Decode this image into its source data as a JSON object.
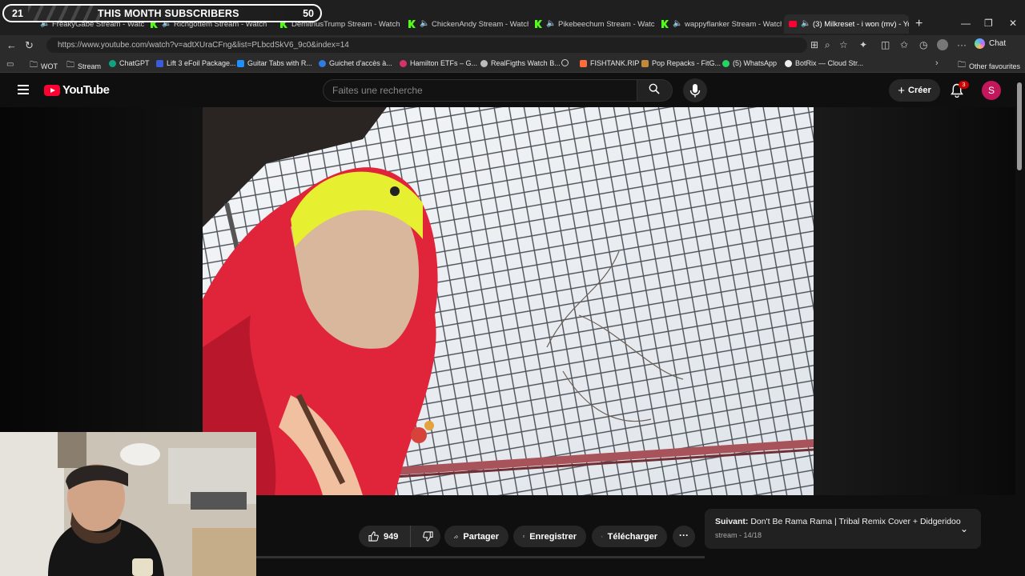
{
  "overlay": {
    "current": "21",
    "title": "THIS MONTH SUBSCRIBERS",
    "goal": "50"
  },
  "tabs": [
    {
      "label": "FreakyGabe Stream - Watch",
      "type": "kick"
    },
    {
      "label": "Richgottem Stream - Watch",
      "type": "kick"
    },
    {
      "label": "DemitriusTrump Stream - Watch L",
      "type": "kick"
    },
    {
      "label": "ChickenAndy Stream - Watch",
      "type": "kick"
    },
    {
      "label": "Pikebeechum Stream - Watch",
      "type": "kick"
    },
    {
      "label": "wappyflanker Stream - Watch",
      "type": "kick"
    },
    {
      "label": "(3) Milkreset - i won (mv) - Yo",
      "type": "youtube"
    }
  ],
  "address": {
    "url": "https://www.youtube.com/watch?v=adtXUraCFng&list=PLbcdSkV6_9c0&index=14"
  },
  "browser": {
    "chat_label": "Chat"
  },
  "bookmarks": [
    {
      "label": "WOT",
      "color": "#9aa0a6"
    },
    {
      "label": "Stream",
      "color": "#9aa0a6"
    },
    {
      "label": "ChatGPT",
      "color": "#10a37f"
    },
    {
      "label": "Lift 3 eFoil Package...",
      "color": "#3b5bdb"
    },
    {
      "label": "Guitar Tabs with R...",
      "color": "#e0e0e0"
    },
    {
      "label": "Guichet d'accès à...",
      "color": "#2f7de1"
    },
    {
      "label": "Hamilton ETFs – G...",
      "color": "#d6336c"
    },
    {
      "label": "RealFigths Watch B...",
      "color": "#bbbbbb"
    },
    {
      "label": "",
      "color": "#bbbbbb"
    },
    {
      "label": "FISHTANK.RIP",
      "color": "#ff6b3d"
    },
    {
      "label": "Pop Repacks - FitG...",
      "color": "#c08a3a"
    },
    {
      "label": "(5) WhatsApp",
      "color": "#25d366"
    },
    {
      "label": "BotRix — Cloud Str...",
      "color": "#eeeeee"
    }
  ],
  "other_favourites": "Other favourites",
  "youtube": {
    "logo": "YouTube",
    "search_placeholder": "Faites une recherche",
    "create_label": "Créer",
    "notif_count": "3",
    "avatar_letter": "S"
  },
  "actions": {
    "likes": "949",
    "share": "Partager",
    "save": "Enregistrer",
    "download": "Télécharger"
  },
  "up_next": {
    "label": "Suivant:",
    "title": "Don't Be Rama Rama | Tribal Remix Cover + Didgeridoo",
    "meta": "stream - 14/18"
  },
  "colors": {
    "yt_red": "#ff0033",
    "kick_green": "#53fc18",
    "hoodie_red": "#e0243a"
  }
}
